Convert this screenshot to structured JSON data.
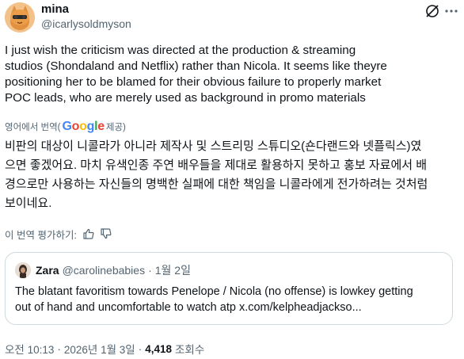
{
  "author": {
    "display_name": "mina",
    "handle": "@icarlysoldmyson"
  },
  "tweet": {
    "text": "I just wish the criticism was directed at the production & streaming\nstudios (Shondaland and Netflix) rather than Nicola. It seems like theyre\npositioning her to be blamed for their obvious failure to properly market\nPOC leads, who are merely used as background in promo materials"
  },
  "translation": {
    "source_label": "영어에서 번역(",
    "provider_logo": "Google",
    "provider_suffix": "제공)",
    "text": "비판의 대상이 니콜라가 아니라 제작사 및 스트리밍 스튜디오(숀다랜드와 넷플릭스)였\n으면 좋겠어요. 마치 유색인종 주연 배우들을 제대로 활용하지 못하고 홍보 자료에서 배\n경으로만 사용하는 자신들의 명백한 실패에 대한 책임을 니콜라에게 전가하려는 것처럼\n보이네요.",
    "rate_label": "이 번역 평가하기:"
  },
  "quote": {
    "display_name": "Zara",
    "handle": "@carolinebabies",
    "separator": "·",
    "date": "1월 2일",
    "text": "The blatant favoritism towards Penelope / Nicola (no offense) is lowkey getting\nout of hand and uncomfortable to watch atp x.com/kelpheadjackso..."
  },
  "meta": {
    "time": "오전 10:13",
    "dot": "·",
    "date": "2026년 1월 3일",
    "dot2": "·",
    "views": "4,418",
    "views_label": "조회수"
  },
  "icons": {
    "grok": "grok-icon",
    "more": "more-icon",
    "thumbs_up": "thumbs-up-icon",
    "thumbs_down": "thumbs-down-icon"
  },
  "colors": {
    "text": "#0f1419",
    "secondary": "#536471",
    "border": "#cfd9de",
    "google_blue": "#4285F4",
    "google_red": "#EA4335",
    "google_yellow": "#FBBC05",
    "google_green": "#34A853"
  }
}
